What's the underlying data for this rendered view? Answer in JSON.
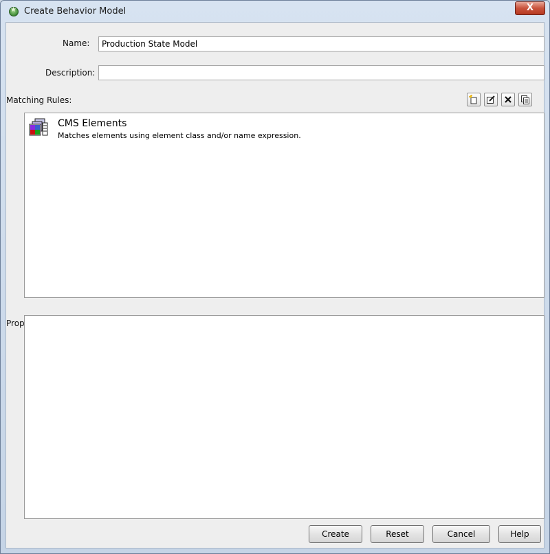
{
  "window": {
    "title": "Create Behavior Model",
    "close_label": "X"
  },
  "form": {
    "name_label": "Name:",
    "name_value": "Production State Model",
    "description_label": "Description:",
    "description_value": ""
  },
  "matching_rules": {
    "label": "Matching Rules:",
    "toolbar": [
      "new-icon",
      "edit-icon",
      "delete-icon",
      "copy-icon"
    ],
    "items": [
      {
        "title": "CMS Elements",
        "description": "Matches elements using element class and/or name expression.",
        "icon": "cms-elements-icon"
      }
    ]
  },
  "property_pages": {
    "label": "Property Pages:",
    "toolbar": [
      "new-icon",
      "find-icon",
      "edit-icon",
      "copy-icon",
      "delete-icon"
    ]
  },
  "buttons": {
    "create": "Create",
    "reset": "Reset",
    "cancel": "Cancel",
    "help": "Help"
  }
}
